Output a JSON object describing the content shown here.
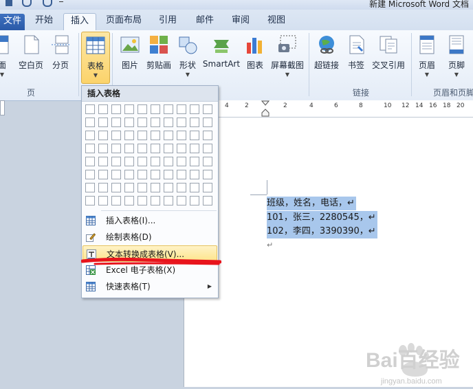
{
  "window": {
    "title": "新建 Microsoft Word 文档"
  },
  "tabs": [
    {
      "label": "文件"
    },
    {
      "label": "开始"
    },
    {
      "label": "插入"
    },
    {
      "label": "页面布局"
    },
    {
      "label": "引用"
    },
    {
      "label": "邮件"
    },
    {
      "label": "审阅"
    },
    {
      "label": "视图"
    }
  ],
  "ribbon": {
    "buttons": [
      {
        "label": "面"
      },
      {
        "label": "空白页"
      },
      {
        "label": "分页"
      },
      {
        "label": "表格"
      },
      {
        "label": "图片"
      },
      {
        "label": "剪贴画"
      },
      {
        "label": "形状"
      },
      {
        "label": "SmartArt"
      },
      {
        "label": "图表"
      },
      {
        "label": "屏幕截图"
      },
      {
        "label": "超链接"
      },
      {
        "label": "书签"
      },
      {
        "label": "交叉引用"
      },
      {
        "label": "页眉"
      },
      {
        "label": "页脚"
      }
    ],
    "groups": [
      {
        "label": "页"
      },
      {
        "label": "链接"
      },
      {
        "label": "页眉和页脚"
      }
    ]
  },
  "ruler": {
    "ticks": [
      "4",
      "2",
      "2",
      "4",
      "6",
      "8",
      "10",
      "12",
      "14",
      "16",
      "18",
      "20"
    ]
  },
  "dropdown": {
    "title": "插入表格",
    "items": [
      {
        "label": "插入表格(I)..."
      },
      {
        "label": "绘制表格(D)"
      },
      {
        "label": "文本转换成表格(V)..."
      },
      {
        "label": "Excel 电子表格(X)"
      },
      {
        "label": "快速表格(T)"
      }
    ]
  },
  "document": {
    "lines": [
      "班级，姓名，电话，↵",
      "101，张三，2280545，↵",
      "102，李四，3390390，↵"
    ],
    "paragraph_mark": "↵"
  },
  "watermark": {
    "brand": "Bai百经验",
    "url": "jingyan.baidu.com"
  },
  "colors": {
    "selection": "#a8c7ec",
    "highlight": "#fde48a",
    "red_mark": "#e8141c"
  }
}
